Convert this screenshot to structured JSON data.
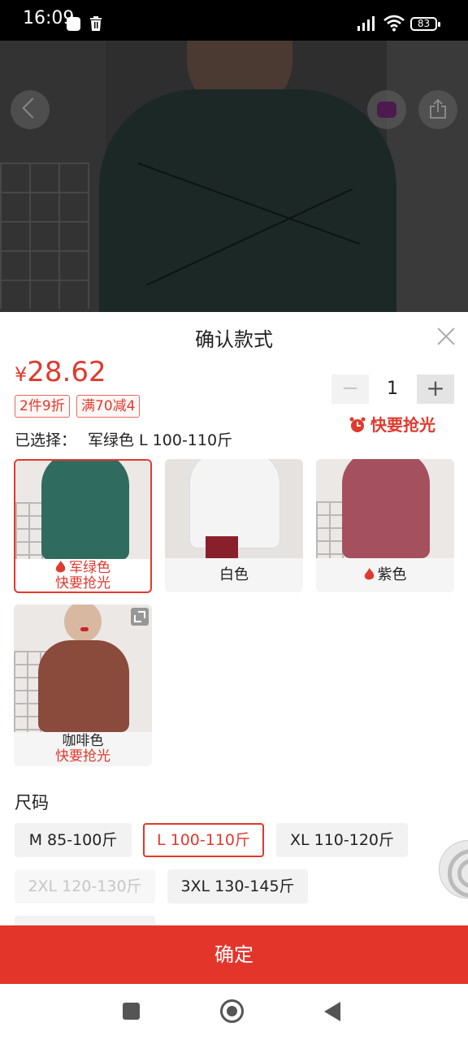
{
  "status_bar": {
    "time": "16:09",
    "battery": "83"
  },
  "sheet": {
    "title": "确认款式",
    "price": {
      "currency": "¥",
      "value": "28.62"
    },
    "promos": [
      "2件9折",
      "满70减4"
    ],
    "quantity": "1",
    "minus_symbol": "−",
    "plus_symbol": "+",
    "hurry_label": "快要抢光",
    "selected_prefix": "已选择：",
    "selected_value": "军绿色 L 100-110斤"
  },
  "colors": [
    {
      "name": "军绿色",
      "tag": "快要抢光",
      "hot": true,
      "shirt": "#2f6b5e"
    },
    {
      "name": "白色",
      "tag": "",
      "hot": false,
      "shirt": "#f4f4f4"
    },
    {
      "name": "紫色",
      "tag": "",
      "hot": true,
      "shirt": "#a4505e"
    },
    {
      "name": "咖啡色",
      "tag": "快要抢光",
      "hot": false,
      "shirt": "#8a4a3c"
    }
  ],
  "size": {
    "title": "尺码",
    "options": [
      "M 85-100斤",
      "L 100-110斤",
      "XL 110-120斤",
      "2XL 120-130斤",
      "3XL 130-145斤"
    ],
    "selected": "L 100-110斤",
    "disabled": "2XL 120-130斤"
  },
  "confirm_label": "确定",
  "accent_color": "#e4352b"
}
